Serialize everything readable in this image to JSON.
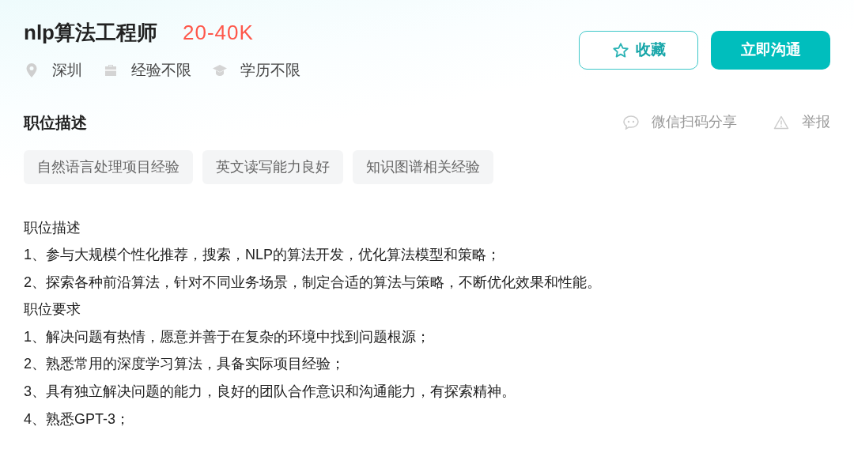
{
  "job": {
    "title": "nlp算法工程师",
    "salary": "20-40K"
  },
  "meta": [
    {
      "kind": "location",
      "text": "深圳"
    },
    {
      "kind": "experience",
      "text": "经验不限"
    },
    {
      "kind": "education",
      "text": "学历不限"
    }
  ],
  "buttons": {
    "favorite": "收藏",
    "chat": "立即沟通"
  },
  "section": {
    "title": "职位描述",
    "share": "微信扫码分享",
    "report": "举报"
  },
  "tags": [
    "自然语言处理项目经验",
    "英文读写能力良好",
    "知识图谱相关经验"
  ],
  "description": [
    "职位描述",
    "1、参与大规模个性化推荐，搜索，NLP的算法开发，优化算法模型和策略；",
    "2、探索各种前沿算法，针对不同业务场景，制定合适的算法与策略，不断优化效果和性能。",
    "职位要求",
    "1、解决问题有热情，愿意并善于在复杂的环境中找到问题根源；",
    "2、熟悉常用的深度学习算法，具备实际项目经验；",
    "3、具有独立解决问题的能力，良好的团队合作意识和沟通能力，有探索精神。",
    "4、熟悉GPT-3；"
  ]
}
